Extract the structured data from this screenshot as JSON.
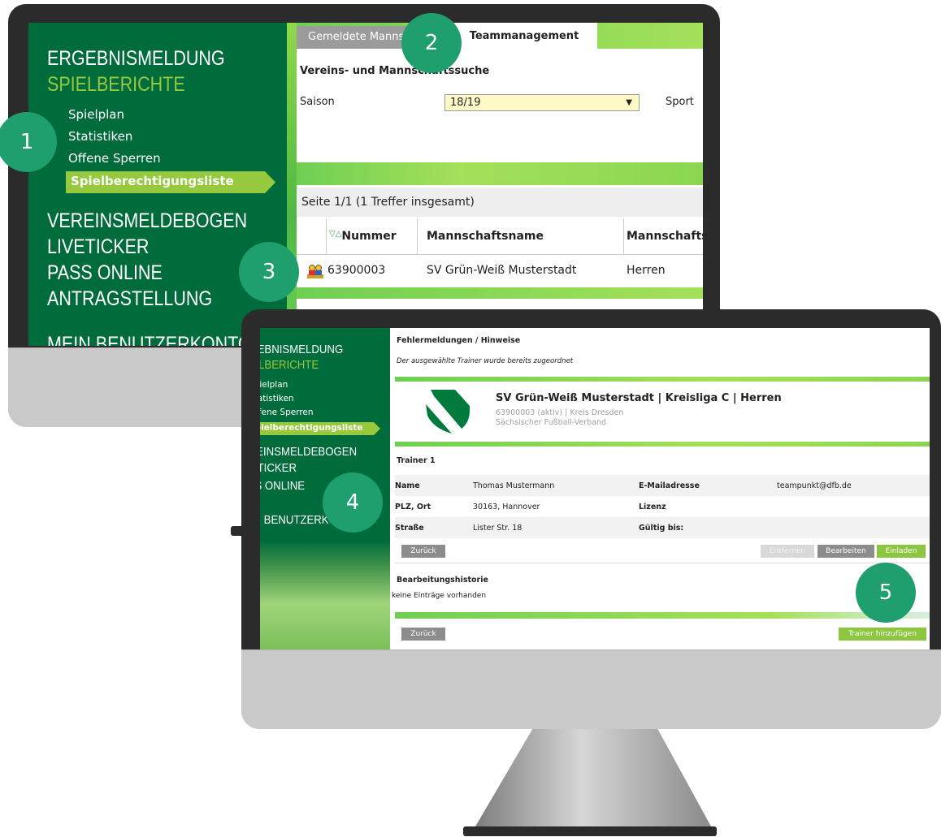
{
  "back_screen": {
    "sidebar": {
      "menu_top": [
        "ERGEBNISMELDUNG",
        "SPIELBERICHTE"
      ],
      "sub_items": [
        "Spielplan",
        "Statistiken",
        "Offene Sperren"
      ],
      "active_item": "Spielberechtigungsliste",
      "menu_bottom": [
        "VEREINSMELDEBOGEN",
        "LIVETICKER",
        "PASS ONLINE",
        "ANTRAGSTELLUNG",
        "MEIN BENUTZERKONTO"
      ]
    },
    "tabs": [
      "Gemeldete Mannschaften",
      "Teammanagement"
    ],
    "section_title": "Vereins- und Mannschaftssuche",
    "filter": {
      "label": "Saison",
      "value": "18/19",
      "next_label": "Sport"
    },
    "pager": "Seite 1/1 (1 Treffer insgesamt)",
    "table": {
      "sort_marker": "▽△",
      "headers": [
        "Nummer",
        "Mannschaftsname",
        "Mannschaftsart"
      ],
      "rows": [
        {
          "nummer": "63900003",
          "name": "SV Grün-Weiß Musterstadt",
          "art": "Herren"
        }
      ]
    }
  },
  "front_screen": {
    "sidebar": {
      "menu_top": [
        "ERGEBNISMELDUNG",
        "SPIELBERICHTE"
      ],
      "sub_items": [
        "Spielplan",
        "Statistiken",
        "Offene Sperren"
      ],
      "active_item": "Spielberechtigungsliste",
      "menu_bottom": [
        "VEREINSMELDEBOGEN",
        "LIVETICKER",
        "PASS ONLINE",
        "MEIN BENUTZERKONTO"
      ]
    },
    "messages_title": "Fehlermeldungen / Hinweise",
    "message": "Der ausgewählte Trainer wurde bereits zugeordnet",
    "team": {
      "title": "SV Grün-Weiß Musterstadt | Kreisliga C | Herren",
      "subtitle1": "63900003 (aktiv) | Kreis Dresden",
      "subtitle2": "Sächsischer Fußball-Verband"
    },
    "trainer_heading": "Trainer 1",
    "fields": {
      "name_label": "Name",
      "name_value": "Thomas Mustermann",
      "email_label": "E-Mailadresse",
      "email_value": "teampunkt@dfb.de",
      "plz_label": "PLZ, Ort",
      "plz_value": "30163,  Hannover",
      "lizenz_label": "Lizenz",
      "strasse_label": "Straße",
      "strasse_value": "Lister Str. 18",
      "gueltig_label": "Gültig bis:"
    },
    "buttons": {
      "back": "Zurück",
      "remove": "Entfernen",
      "edit": "Bearbeiten",
      "invite": "Einladen",
      "add_trainer": "Trainer hinzufügen"
    },
    "history_title": "Bearbeitungshistorie",
    "history_empty": "keine Einträge vorhanden"
  },
  "callouts": [
    "1",
    "2",
    "3",
    "4",
    "5"
  ],
  "colors": {
    "dfb_green": "#006c3b",
    "lime": "#96c93d",
    "callout": "#1f9e6e"
  }
}
